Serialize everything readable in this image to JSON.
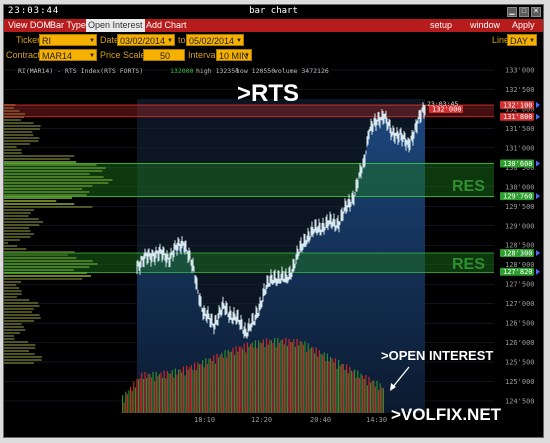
{
  "window": {
    "clock": "23:03:44",
    "title": "bar chart"
  },
  "menu": {
    "items": [
      "View DOM",
      "Bar Type",
      "Open Interest",
      "Add Chart"
    ],
    "active": "Open Interest",
    "right": [
      "setup",
      "window",
      "Apply"
    ]
  },
  "controls": {
    "ticker_label": "Ticker",
    "ticker": "RI",
    "date_label": "Date",
    "date_from": "03/02/2014",
    "to_label": "to",
    "date_to": "05/02/2014",
    "line_label": "Line",
    "line": "DAY",
    "contract_label": "Contract",
    "contract": "MAR14",
    "price_scale_label": "Price Scale",
    "price_scale": "50",
    "interval_label": "Interval",
    "interval": "10 MIN"
  },
  "info": {
    "symbol": "RI(MAR14) - RTS Index(RTS FORTS)",
    "last": "132000",
    "high": "high 132350",
    "low": "low 120550",
    "volume": "volume 3472126"
  },
  "overlay": {
    "title": ">RTS",
    "open_interest": ">OPEN INTEREST",
    "watermark": ">VOLFIX.NET",
    "cursor_time": "23:03:45"
  },
  "zones": [
    {
      "label": "RES",
      "from": 129750,
      "to": 130600
    },
    {
      "label": "RES",
      "from": 127800,
      "to": 128300
    }
  ],
  "price_axis": {
    "ticks": [
      "133'000",
      "132'500",
      "132'000",
      "131'500",
      "131'000",
      "130'500",
      "130'000",
      "129'500",
      "129'000",
      "128'500",
      "128'000",
      "127'500",
      "127'000",
      "126'500",
      "126'000",
      "125'500",
      "125'000",
      "124'500"
    ]
  },
  "markers": [
    {
      "label": "132'100",
      "price": 132100,
      "color": "#d32f2f"
    },
    {
      "label": "131'800",
      "price": 131800,
      "color": "#d32f2f"
    },
    {
      "label": "130'600",
      "price": 130600,
      "color": "#2e9e2e"
    },
    {
      "label": "129'760",
      "price": 129760,
      "color": "#2e9e2e"
    },
    {
      "label": "128'300",
      "price": 128300,
      "color": "#2e9e2e"
    },
    {
      "label": "127'820",
      "price": 127820,
      "color": "#2e9e2e"
    }
  ],
  "price_tag": "132'000",
  "time_axis": {
    "labels": [
      "18:10",
      "12:20",
      "20:40",
      "14:30"
    ]
  }
}
